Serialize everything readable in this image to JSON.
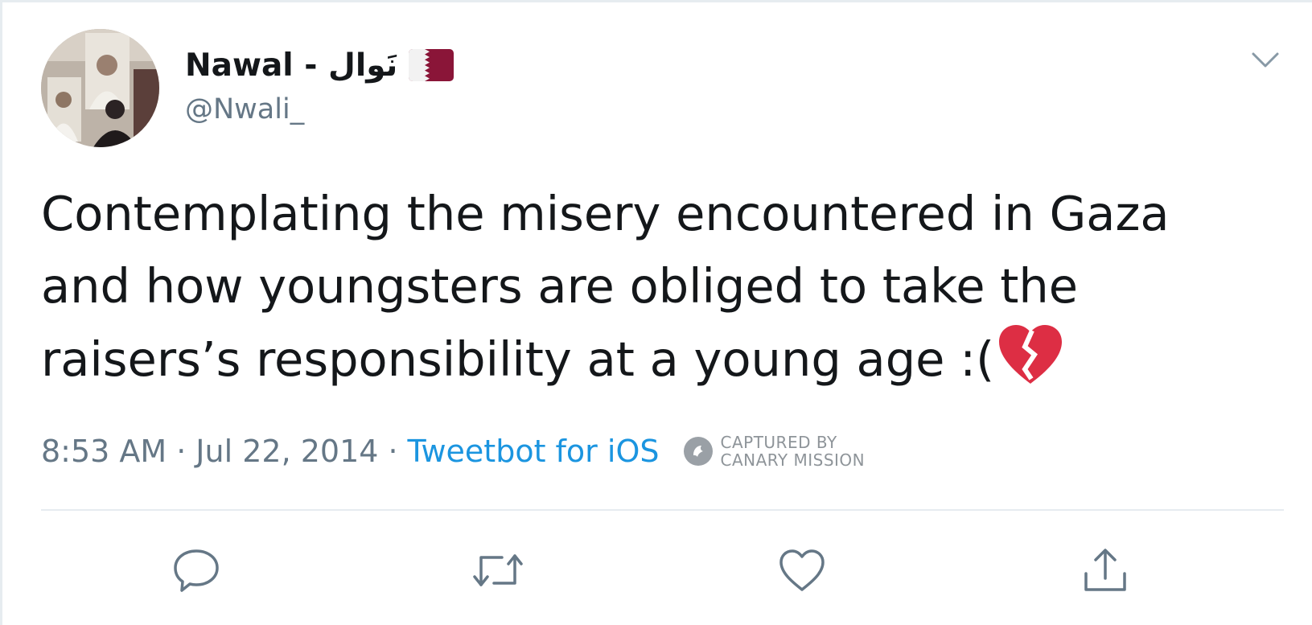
{
  "tweet": {
    "display_name": "Nawal - نَوال",
    "handle": "@Nwali_",
    "text_lines": [
      "Contemplating the misery encountered in Gaza",
      "and how youngsters are obliged to take the",
      "raisers’s responsibility at a young age :("
    ],
    "time": "8:53 AM",
    "separator": "·",
    "date": "Jul 22, 2014",
    "source": "Tweetbot for iOS"
  },
  "watermark": {
    "line1": "CAPTURED BY",
    "line2": "CANARY MISSION"
  },
  "colors": {
    "text": "#14171a",
    "secondary": "#657786",
    "link": "#1b95e0",
    "flag_maroon": "#8a1538",
    "broken_heart": "#dd2e44"
  },
  "icons": {
    "avatar": "profile-photo",
    "flag": "qatar-flag-icon",
    "caret": "chevron-down-icon",
    "emoji": "broken-heart-icon",
    "reply": "reply-icon",
    "retweet": "retweet-icon",
    "like": "like-heart-icon",
    "share": "share-icon"
  }
}
